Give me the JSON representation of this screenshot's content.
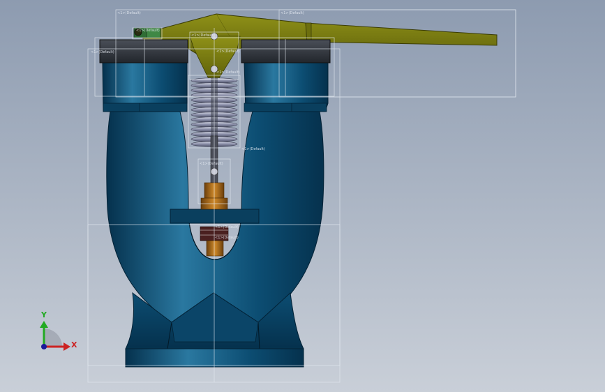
{
  "viewport": {
    "background_top": "#8d9bb0",
    "background_bottom": "#c9cfd8"
  },
  "colors": {
    "body": "#0c4d72",
    "body_dark": "#05314d",
    "body_light": "#2a78a0",
    "cap": "#333840",
    "lever": "#7b7d12",
    "lever_dark": "#4f5108",
    "spring": "#8a8ea8",
    "brass": "#b8731f",
    "bbox": "#e6ebf2"
  },
  "component_labels": {
    "lever": "<1>(Default)",
    "bracket": "<1>(Default)",
    "pin_top": "<1>(Default)",
    "spring": "<1>(Default)",
    "stem": "<1>(Default)",
    "disc": "<1>(Default)",
    "seat": "<1>(Default)",
    "body": "<1>(Default)"
  },
  "triad": {
    "y_label": "Y",
    "x_label": "X",
    "y_color": "#22aa22",
    "x_color": "#cc2222",
    "origin_color": "#1a1a99"
  }
}
